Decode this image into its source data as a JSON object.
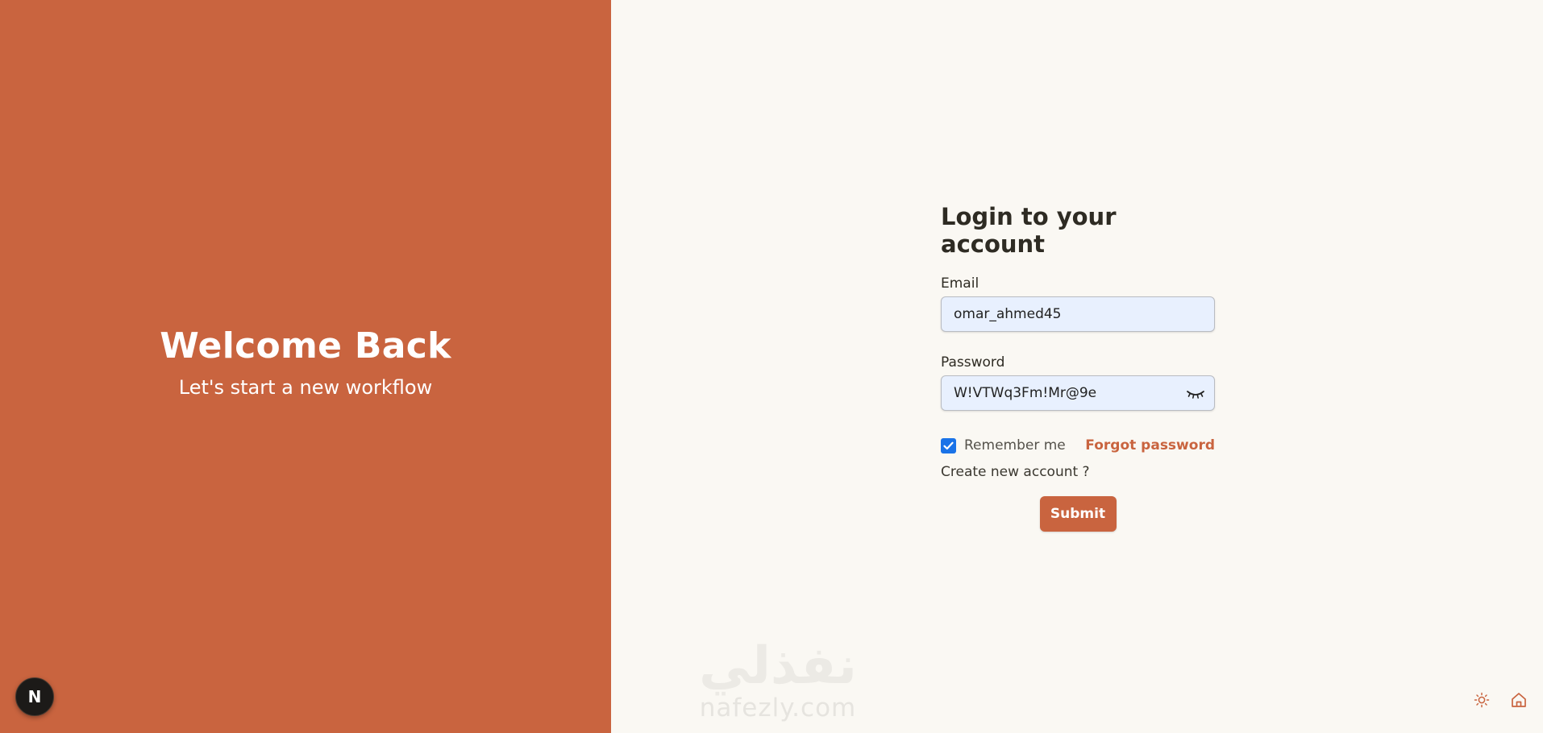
{
  "left": {
    "title": "Welcome Back",
    "subtitle": "Let's start a new workflow",
    "badge": "N"
  },
  "form": {
    "heading": "Login to your account",
    "email_label": "Email",
    "email_value": "omar_ahmed45",
    "password_label": "Password",
    "password_value": "W!VTWq3Fm!Mr@9e",
    "remember_label": "Remember me",
    "remember_checked": true,
    "forgot_label": "Forgot password",
    "create_label": "Create new account ?",
    "submit_label": "Submit"
  },
  "watermark": {
    "arabic": "نفذلي",
    "latin": "nafezly.com"
  },
  "icons": {
    "password_toggle": "eye-closed-icon",
    "theme_toggle": "sun-icon",
    "home": "home-icon"
  },
  "colors": {
    "brand": "#c9643f",
    "background": "#faf8f3",
    "input_bg": "#e8f0fe",
    "checkbox": "#1a73e8"
  }
}
